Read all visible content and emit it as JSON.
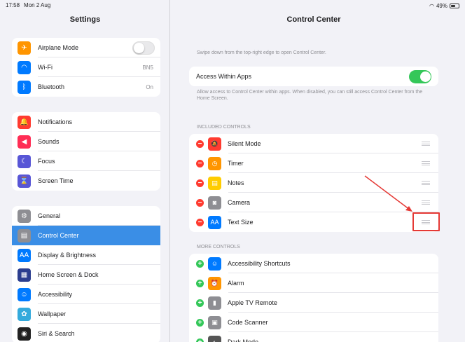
{
  "status": {
    "time": "17:58",
    "date": "Mon 2 Aug",
    "battery": "49%"
  },
  "sidebar": {
    "title": "Settings",
    "group1": [
      {
        "label": "Airplane Mode",
        "icon": "airplane-icon",
        "color": "#ff9500",
        "glyph": "✈"
      },
      {
        "label": "Wi-Fi",
        "value": "BN5",
        "icon": "wifi-icon",
        "color": "#007aff",
        "glyph": "◠"
      },
      {
        "label": "Bluetooth",
        "value": "On",
        "icon": "bluetooth-icon",
        "color": "#007aff",
        "glyph": "ᛒ"
      }
    ],
    "group2": [
      {
        "label": "Notifications",
        "icon": "bell-icon",
        "color": "#ff3b30",
        "glyph": "🔔"
      },
      {
        "label": "Sounds",
        "icon": "speaker-icon",
        "color": "#ff2d55",
        "glyph": "◀"
      },
      {
        "label": "Focus",
        "icon": "moon-icon",
        "color": "#5856d6",
        "glyph": "☾"
      },
      {
        "label": "Screen Time",
        "icon": "hourglass-icon",
        "color": "#5856d6",
        "glyph": "⌛"
      }
    ],
    "group3": [
      {
        "label": "General",
        "icon": "gear-icon",
        "color": "#8e8e93",
        "glyph": "⚙"
      },
      {
        "label": "Control Center",
        "icon": "toggles-icon",
        "color": "#8e8e93",
        "glyph": "▤"
      },
      {
        "label": "Display & Brightness",
        "icon": "text-size-icon",
        "color": "#007aff",
        "glyph": "AA"
      },
      {
        "label": "Home Screen & Dock",
        "icon": "grid-icon",
        "color": "#2c3e8f",
        "glyph": "▦"
      },
      {
        "label": "Accessibility",
        "icon": "accessibility-icon",
        "color": "#007aff",
        "glyph": "☺"
      },
      {
        "label": "Wallpaper",
        "icon": "flower-icon",
        "color": "#34aadc",
        "glyph": "✿"
      },
      {
        "label": "Siri & Search",
        "icon": "siri-icon",
        "color": "#222",
        "glyph": "◉"
      }
    ]
  },
  "main": {
    "title": "Control Center",
    "intro": "Swipe down from the top-right edge to open Control Center.",
    "access_label": "Access Within Apps",
    "access_desc": "Allow access to Control Center within apps. When disabled, you can still access Control Center from the Home Screen.",
    "included_header": "INCLUDED CONTROLS",
    "included": [
      {
        "label": "Silent Mode",
        "icon": "bell-slash-icon",
        "color": "#ff3b30",
        "glyph": "🔕"
      },
      {
        "label": "Timer",
        "icon": "timer-icon",
        "color": "#ff9500",
        "glyph": "◷"
      },
      {
        "label": "Notes",
        "icon": "notes-icon",
        "color": "#ffcc00",
        "glyph": "▤"
      },
      {
        "label": "Camera",
        "icon": "camera-icon",
        "color": "#8e8e93",
        "glyph": "◙"
      },
      {
        "label": "Text Size",
        "icon": "text-size-icon",
        "color": "#007aff",
        "glyph": "AA"
      }
    ],
    "more_header": "MORE CONTROLS",
    "more": [
      {
        "label": "Accessibility Shortcuts",
        "icon": "accessibility-icon",
        "color": "#007aff",
        "glyph": "☺"
      },
      {
        "label": "Alarm",
        "icon": "alarm-icon",
        "color": "#ff9500",
        "glyph": "⏰"
      },
      {
        "label": "Apple TV Remote",
        "icon": "remote-icon",
        "color": "#8e8e93",
        "glyph": "▮"
      },
      {
        "label": "Code Scanner",
        "icon": "qr-icon",
        "color": "#8e8e93",
        "glyph": "▣"
      },
      {
        "label": "Dark Mode",
        "icon": "dark-mode-icon",
        "color": "#555",
        "glyph": "◐"
      }
    ]
  }
}
